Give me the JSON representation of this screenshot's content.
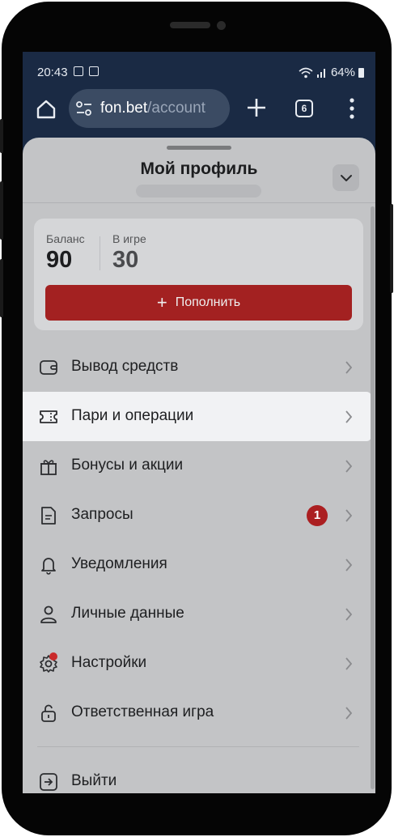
{
  "status_bar": {
    "time": "20:43",
    "battery": "64%",
    "icons": [
      "gallery-icon",
      "app-notification-icon",
      "wifi-icon",
      "signal-icon",
      "battery-icon"
    ]
  },
  "browser": {
    "url_domain": "fon.bet",
    "url_path": "/account",
    "tab_count": "6",
    "icons": [
      "home-icon",
      "site-settings-icon",
      "new-tab-icon",
      "tabs-icon",
      "more-icon"
    ]
  },
  "profile": {
    "title": "Мой профиль"
  },
  "balance": {
    "balance_label": "Баланс",
    "balance_value": "90",
    "in_game_label": "В игре",
    "in_game_value": "30",
    "topup_label": "Пополнить"
  },
  "menu": {
    "items": [
      {
        "label": "Вывод средств",
        "icon": "wallet-icon"
      },
      {
        "label": "Пари и операции",
        "icon": "ticket-icon"
      },
      {
        "label": "Бонусы и акции",
        "icon": "gift-icon"
      },
      {
        "label": "Запросы",
        "icon": "document-icon",
        "badge": "1"
      },
      {
        "label": "Уведомления",
        "icon": "bell-icon"
      },
      {
        "label": "Личные данные",
        "icon": "person-icon"
      },
      {
        "label": "Настройки",
        "icon": "gear-icon"
      },
      {
        "label": "Ответственная игра",
        "icon": "lock-icon"
      }
    ],
    "logout_label": "Выйти"
  },
  "colors": {
    "accent_red": "#a32121",
    "browser_bg": "#1a2a44",
    "active_item_bg": "#f1f2f4"
  }
}
